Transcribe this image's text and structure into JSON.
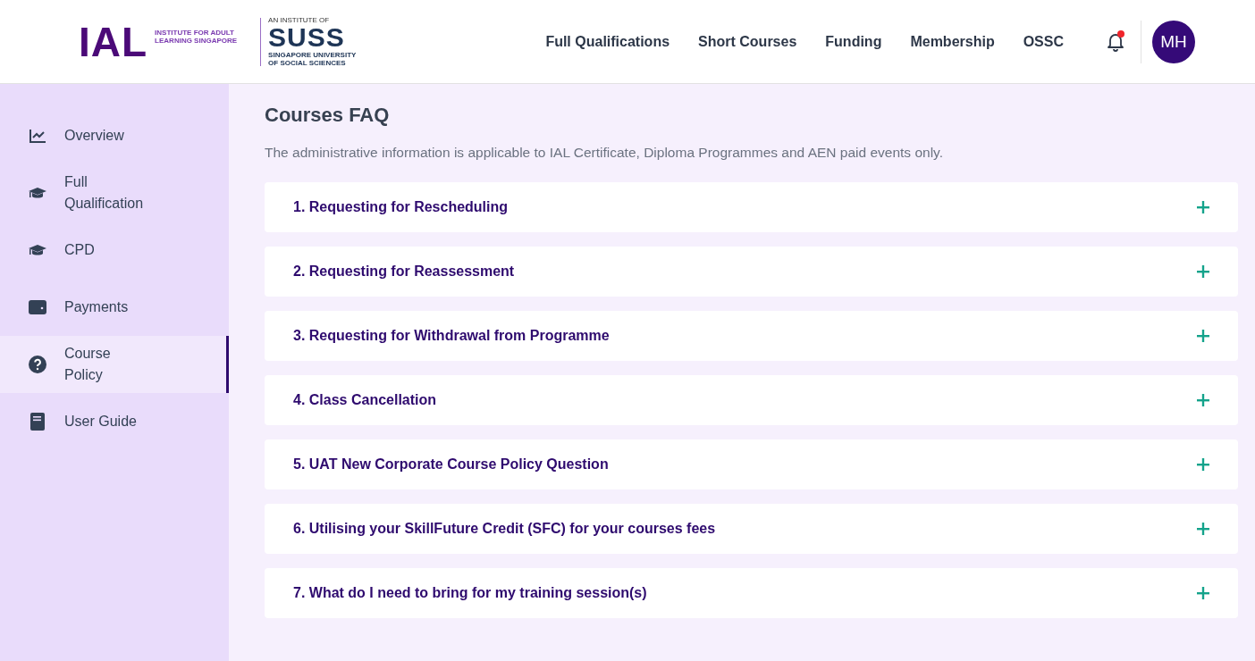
{
  "header": {
    "logo": {
      "mark": "IAL",
      "tagline": "INSTITUTE FOR ADULT LEARNING SINGAPORE",
      "partner_prefix": "AN INSTITUTE OF",
      "partner_name": "SUSS",
      "partner_full": "SINGAPORE UNIVERSITY OF SOCIAL SCIENCES"
    },
    "nav": [
      "Full Qualifications",
      "Short Courses",
      "Funding",
      "Membership",
      "OSSC"
    ],
    "notifications": {
      "unread": true
    },
    "avatar": "MH"
  },
  "sidebar": {
    "items": [
      {
        "label": "Overview",
        "kind": "chart",
        "selected": false
      },
      {
        "label": "Full Qualification",
        "kind": "cap",
        "selected": false
      },
      {
        "label": "CPD",
        "kind": "cap",
        "selected": false
      },
      {
        "label": "Payments",
        "kind": "wallet",
        "selected": false
      },
      {
        "label": "Course Policy",
        "kind": "question",
        "selected": true
      },
      {
        "label": "User Guide",
        "kind": "book",
        "selected": false
      }
    ]
  },
  "page": {
    "title": "Courses FAQ",
    "intro": "The administrative information is applicable to IAL Certificate, Diploma Programmes and AEN paid events only.",
    "faqs": [
      {
        "title": "1. Requesting for Rescheduling",
        "expanded": false
      },
      {
        "title": "2. Requesting for Reassessment",
        "expanded": false
      },
      {
        "title": "3. Requesting for Withdrawal from Programme",
        "expanded": false
      },
      {
        "title": "4. Class Cancellation",
        "expanded": false
      },
      {
        "title": "5. UAT New Corporate Course Policy Question",
        "expanded": false
      },
      {
        "title": "6. Utilising your SkillFuture Credit (SFC) for your courses fees",
        "expanded": false
      },
      {
        "title": "7. What do I need to bring for my training session(s)",
        "expanded": false
      }
    ]
  }
}
